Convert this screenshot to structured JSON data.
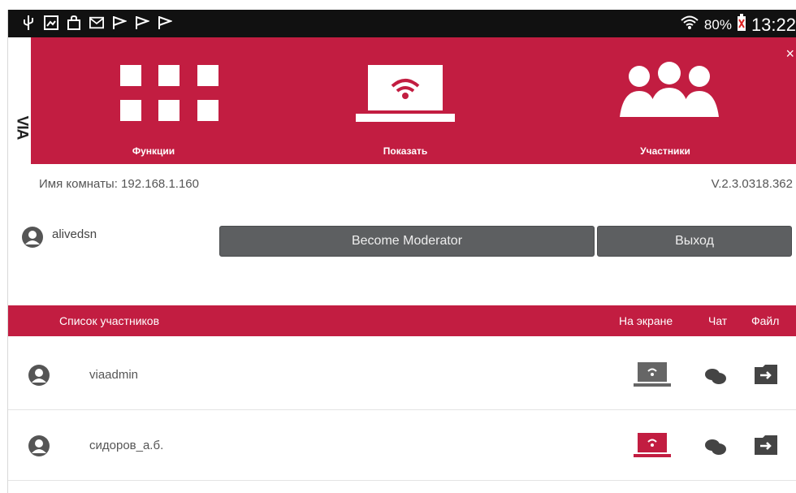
{
  "status_bar": {
    "left_icons": [
      "usb-icon",
      "image-icon",
      "shopping-bag-icon",
      "email-icon",
      "flag-icon",
      "flag-icon",
      "flag-icon"
    ],
    "battery": "80%",
    "time": "13:22"
  },
  "brand": {
    "logo": "VIA"
  },
  "nav": {
    "items": [
      {
        "label": "Функции",
        "icon": "grid-icon"
      },
      {
        "label": "Показать",
        "icon": "laptop-wifi-icon"
      },
      {
        "label": "Участники",
        "icon": "people-icon"
      }
    ],
    "close": "×"
  },
  "room": {
    "name_text": "Имя комнаты: 192.168.1.160",
    "version": "V.2.3.0318.362"
  },
  "current_user": {
    "name": "alivedsn"
  },
  "buttons": {
    "moderator": "Become Moderator",
    "exit": "Выход"
  },
  "participants_header": {
    "title": "Список участников",
    "on_screen": "На экране",
    "chat": "Чат",
    "file": "Файл"
  },
  "participants": [
    {
      "name": "viaadmin",
      "screen_active": false
    },
    {
      "name": "сидоров_а.б.",
      "screen_active": true
    }
  ],
  "colors": {
    "accent": "#c21d41",
    "button": "#5d5f61",
    "screen_active": "#c21d41",
    "screen_inactive": "#666666"
  }
}
